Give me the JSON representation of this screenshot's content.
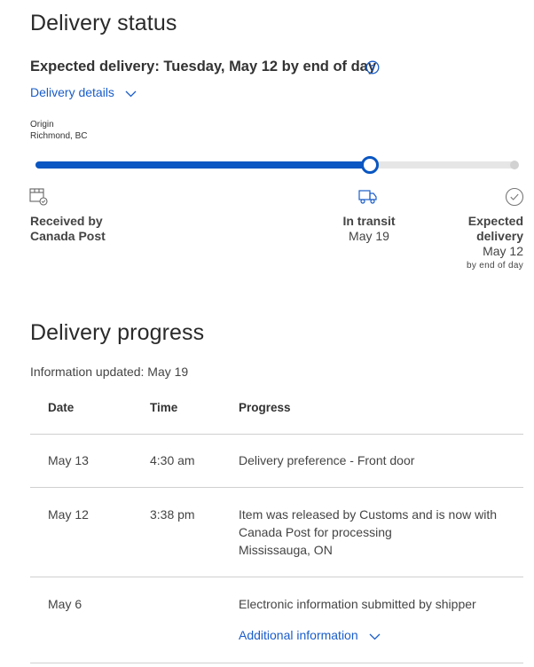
{
  "status": {
    "title": "Delivery status",
    "expected_delivery": "Expected delivery: Tuesday, May 12 by end of day",
    "details_link": "Delivery details",
    "origin_label": "Origin",
    "origin_location": "Richmond, BC",
    "progress_fraction": 0.699,
    "steps": [
      {
        "label_line1": "Received by",
        "label_line2": "Canada Post",
        "date": ""
      },
      {
        "label_line1": "In transit",
        "label_line2": "",
        "date": "May 19"
      },
      {
        "label_line1": "Expected",
        "label_line2": "delivery",
        "date": "May 12",
        "note": "by end of day"
      }
    ]
  },
  "progress": {
    "title": "Delivery progress",
    "updated": "Information updated: May 19",
    "columns": [
      "Date",
      "Time",
      "Progress"
    ],
    "rows": [
      {
        "date": "May 13",
        "time": "4:30 am",
        "lines": [
          "Delivery preference - Front door"
        ]
      },
      {
        "date": "May 12",
        "time": "3:38 pm",
        "lines": [
          "Item was released by Customs and is now with",
          "Canada Post for processing",
          "Mississauga, ON"
        ]
      },
      {
        "date": "May 6",
        "time": "",
        "lines": [
          "Electronic information submitted by shipper"
        ],
        "link": "Additional information"
      }
    ]
  },
  "colors": {
    "accent": "#0a56c2",
    "link": "#1a5dc9",
    "track": "#e6e6e6",
    "divider": "#cfcfcf"
  }
}
